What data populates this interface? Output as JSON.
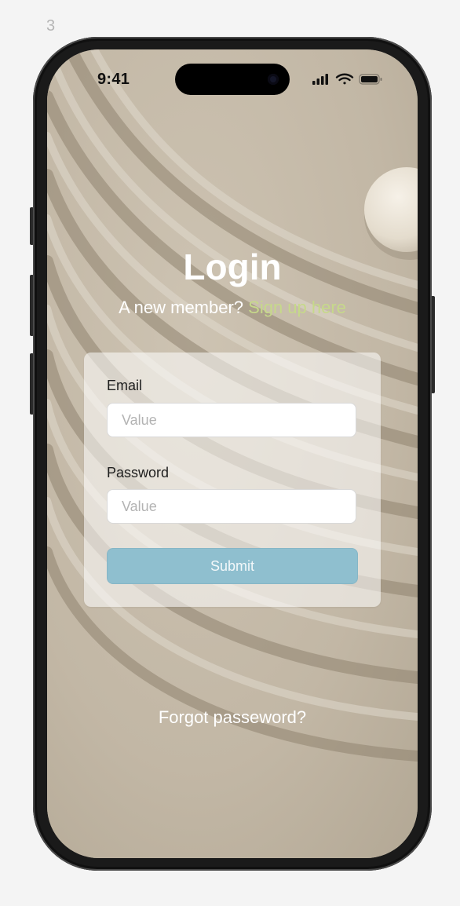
{
  "frame": {
    "label": "3"
  },
  "status_bar": {
    "time": "9:41",
    "icons": [
      "signal-icon",
      "wifi-icon",
      "battery-icon"
    ]
  },
  "header": {
    "title": "Login",
    "subtitle_prefix": "A new member? ",
    "signup_link": "Sign up here"
  },
  "form": {
    "email_label": "Email",
    "email_placeholder": "Value",
    "password_label": "Password",
    "password_placeholder": "Value",
    "submit_label": "Submit"
  },
  "footer": {
    "forgot_password": "Forgot passeword?"
  },
  "colors": {
    "accent_link": "#c6d98a",
    "submit_button": "#8fbfcf",
    "background_sand": "#c6bba9"
  }
}
